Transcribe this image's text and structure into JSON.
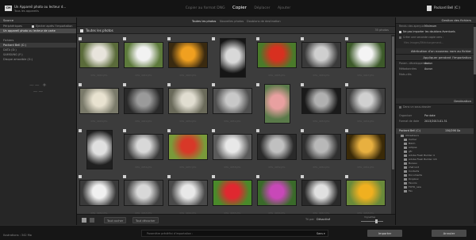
{
  "topbar": {
    "source_badge": "CM",
    "source_title": "Un Appareil photo ou lecteur d...",
    "source_subtitle": "Tous les appareils",
    "modes": [
      "Copier au format DNG",
      "Copier",
      "Déplacer",
      "Ajouter"
    ],
    "active_mode_index": 1,
    "destination_title": "Packard Bell (C:)"
  },
  "left_panel": {
    "source_header": "Source",
    "source_label": "Périphériques",
    "eject_label": "Ejecter après l'importation",
    "device_label": "Un appareil photo ou lecteur de carte",
    "files_label": "Fichiers",
    "drives": [
      "Packard Bell (C:)",
      "DATA (D:)",
      "SAMSUNG (F:)",
      "Disque amovible (G:)"
    ],
    "selected_drive_index": 0,
    "ornament": "~~ ✦ ~~"
  },
  "center": {
    "tabs": [
      "Toutes les photos",
      "Nouvelles photos",
      "Doublons de destination"
    ],
    "active_tab_index": 0,
    "select_all_label": "Toutes les photos",
    "count_label": "35 photos",
    "photos": [
      {
        "name": "IMG_4041.JPG",
        "c1": "#e8e4dc",
        "c2": "#5a6b3a",
        "portrait": false
      },
      {
        "name": "IMG_4042.JPG",
        "c1": "#f2f2f2",
        "c2": "#5d7a3b",
        "portrait": false
      },
      {
        "name": "IMG_4043.JPG",
        "c1": "#f0a020",
        "c2": "#3a2a10",
        "portrait": false
      },
      {
        "name": "IMG_4044.JPG",
        "c1": "#d8d8d8",
        "c2": "#151515",
        "portrait": true
      },
      {
        "name": "IMG_4045.JPG",
        "c1": "#d83020",
        "c2": "#4a7a2a",
        "portrait": false
      },
      {
        "name": "IMG_4046.JPG",
        "c1": "#cfcfcf",
        "c2": "#3a3a3a",
        "portrait": false
      },
      {
        "name": "IMG_4047.JPG",
        "c1": "#f4f4f4",
        "c2": "#3d5a2a",
        "portrait": false
      },
      {
        "name": "IMG_4048.JPG",
        "c1": "#e8e2d0",
        "c2": "#7a7a6a",
        "portrait": false
      },
      {
        "name": "IMG_4049.JPG",
        "c1": "#9a9a9a",
        "c2": "#2a2a2a",
        "portrait": false
      },
      {
        "name": "IMG_4050.JPG",
        "c1": "#e0ddd0",
        "c2": "#6a6a5a",
        "portrait": false
      },
      {
        "name": "IMG_4051.JPG",
        "c1": "#c8c8c8",
        "c2": "#505050",
        "portrait": false
      },
      {
        "name": "IMG_4052.JPG",
        "c1": "#e8a0a0",
        "c2": "#5a7a4a",
        "portrait": true
      },
      {
        "name": "IMG_4053.JPG",
        "c1": "#b0b0b0",
        "c2": "#1a1a1a",
        "portrait": false
      },
      {
        "name": "IMG_4054.JPG",
        "c1": "#d0d0d0",
        "c2": "#404040",
        "portrait": false
      },
      {
        "name": "IMG_4055.JPG",
        "c1": "#e0e0e0",
        "c2": "#202020",
        "portrait": true
      },
      {
        "name": "IMG_4056.JPG",
        "c1": "#d8d8d8",
        "c2": "#3a3a3a",
        "portrait": false
      },
      {
        "name": "IMG_4057.JPG",
        "c1": "#d83828",
        "c2": "#7a9a3a",
        "portrait": false
      },
      {
        "name": "IMG_4058.JPG",
        "c1": "#e8e8e8",
        "c2": "#5a5a5a",
        "portrait": false
      },
      {
        "name": "IMG_4059.JPG",
        "c1": "#c0c0c0",
        "c2": "#2a2a2a",
        "portrait": false
      },
      {
        "name": "IMG_4060.JPG",
        "c1": "#b8b8b8",
        "c2": "#303030",
        "portrait": false
      },
      {
        "name": "IMG_4061.JPG",
        "c1": "#e8b040",
        "c2": "#3a2a08",
        "portrait": false
      },
      {
        "name": "IMG_4062.JPG",
        "c1": "#f0f0f0",
        "c2": "#3a3a3a",
        "portrait": false
      },
      {
        "name": "IMG_4063.JPG",
        "c1": "#d8d8d8",
        "c2": "#404040",
        "portrait": false
      },
      {
        "name": "IMG_4064.JPG",
        "c1": "#e8e8e8",
        "c2": "#4a4a4a",
        "portrait": false
      },
      {
        "name": "IMG_4065.JPG",
        "c1": "#e02830",
        "c2": "#4a8a2a",
        "portrait": false
      },
      {
        "name": "IMG_4066.JPG",
        "c1": "#c848b8",
        "c2": "#3a6a2a",
        "portrait": false
      },
      {
        "name": "IMG_4067.JPG",
        "c1": "#e0e0e0",
        "c2": "#2a2a2a",
        "portrait": false
      },
      {
        "name": "IMG_4068.JPG",
        "c1": "#f0b020",
        "c2": "#6a8a3a",
        "portrait": false
      }
    ],
    "grid_label": "Grille",
    "loupe_label": "Loupe",
    "check_all_btn": "Tout cocher",
    "uncheck_all_btn": "Tout décocher",
    "sort_label": "Tri par",
    "sort_value": "Désactivé",
    "thumb_label": "Vignettes"
  },
  "right_panel": {
    "file_handling_header": "Gestion des fichiers",
    "previews_label": "Rendu des aperçus",
    "previews_value": "Minimum",
    "no_duplicates_label": "Ne pas importer les doublons éventuels",
    "second_copy_label": "Créer une seconde copie vers :",
    "second_copy_path": "Mes Images/Téléchargement...",
    "rename_header": "Attribution d'un nouveau nom au fichier",
    "apply_header": "Appliquer pendant l'importation",
    "dev_settings_label": "Param. développement",
    "dev_settings_value": "Aucun",
    "metadata_label": "Métadonnées",
    "metadata_value": "Aucun",
    "keywords_label": "Mots-clés",
    "destination_header": "Destination",
    "subfolder_label": "Dans un sous-dossier",
    "organize_label": "Organiser",
    "organize_value": "Par date",
    "date_format_label": "Format de date",
    "date_format_value": "2013/2013-01-31",
    "drive_label": "Packard Bell (C:)",
    "drive_free": "150/298 Go",
    "folders": [
      "Utilisateurs",
      "Ilucher",
      "Bikim",
      "eclipse",
      "gfc",
      "Adobe Flash Builder 4",
      "Adobe Flash Builder 4.6",
      "Bureau",
      "chat lord",
      "Contacts",
      "Documents",
      "Dropbox",
      "Favoris",
      "FOTO_new",
      "Fav"
    ]
  },
  "footer": {
    "info": "Ilustrations : 342 Mo",
    "preset_label": "Paramètre prédéfini d'importation :",
    "preset_value": "Sans ▾",
    "import_btn": "Importer",
    "cancel_btn": "Annuler"
  }
}
